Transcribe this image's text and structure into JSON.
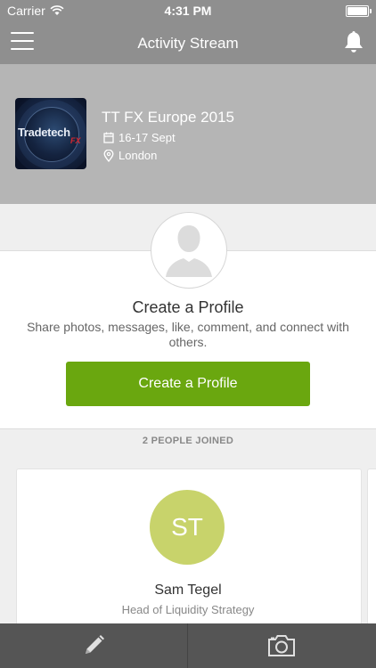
{
  "status_bar": {
    "carrier": "Carrier",
    "time": "4:31 PM"
  },
  "nav": {
    "title": "Activity Stream"
  },
  "event": {
    "thumbnail_text": "Tradetech",
    "thumbnail_badge": "FX",
    "name": "TT FX Europe 2015",
    "dates": "16-17 Sept",
    "location": "London"
  },
  "profile_prompt": {
    "title": "Create a Profile",
    "description": "Share photos, messages, like, comment, and connect with others.",
    "button_label": "Create a Profile"
  },
  "joined": {
    "label": "2 PEOPLE JOINED"
  },
  "people": [
    {
      "initials": "ST",
      "name": "Sam Tegel",
      "title": "Head of Liquidity Strategy"
    }
  ],
  "colors": {
    "header_bg": "#8f8f8f",
    "banner_bg": "#b5b5b5",
    "primary_button": "#6aa70f",
    "initials_bg": "#c8d36b",
    "toolbar_bg": "#555555"
  },
  "icons": {
    "menu": "hamburger-icon",
    "notifications": "bell-icon",
    "calendar": "calendar-icon",
    "location": "location-pin-icon",
    "compose": "pencil-icon",
    "camera": "camera-icon"
  }
}
